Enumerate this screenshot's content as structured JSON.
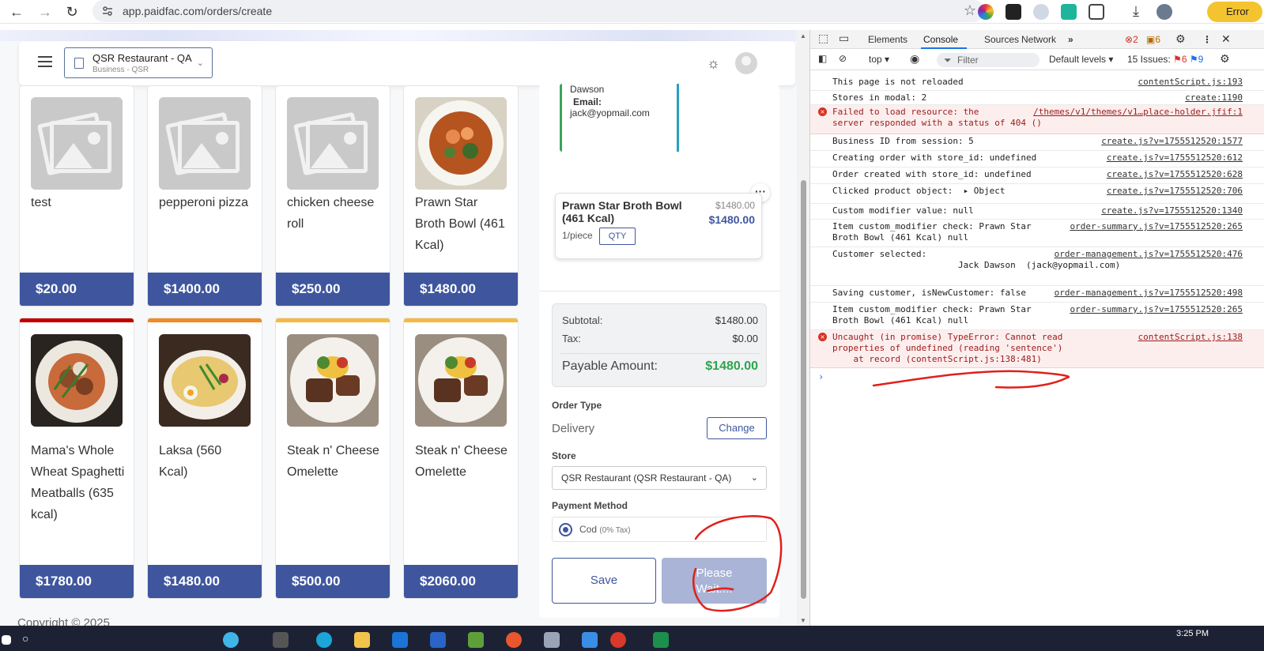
{
  "browser": {
    "url": "app.paidfac.com/orders/create",
    "error_pill": "Error"
  },
  "header": {
    "store_name": "QSR Restaurant - QA",
    "store_sub": "Business - QSR"
  },
  "products": [
    {
      "name": "test",
      "price": "$20.00",
      "image": "placeholder"
    },
    {
      "name": "pepperoni pizza",
      "price": "$1400.00",
      "image": "placeholder"
    },
    {
      "name": "chicken cheese roll",
      "price": "$250.00",
      "image": "placeholder"
    },
    {
      "name": "Prawn Star Broth Bowl (461 Kcal)",
      "price": "$1480.00",
      "image": "soup"
    },
    {
      "name": "Mama's Whole Wheat Spaghetti Meatballs (635 kcal)",
      "price": "$1780.00",
      "image": "pasta",
      "band": "#c00000"
    },
    {
      "name": "Laksa (560 Kcal)",
      "price": "$1480.00",
      "image": "laksa",
      "band": "#f08a24"
    },
    {
      "name": "Steak n' Cheese Omelette",
      "price": "$500.00",
      "image": "steak",
      "band": "#f5b942"
    },
    {
      "name": "Steak n' Cheese Omelette",
      "price": "$2060.00",
      "image": "steak",
      "band": "#f5b942"
    }
  ],
  "customer": {
    "name_line": "Dawson",
    "email_label": "Email:",
    "email": "jack@yopmail.com"
  },
  "cart_item": {
    "name": "Prawn Star Broth Bowl (461 Kcal)",
    "original_price": "$1480.00",
    "price": "$1480.00",
    "unit": "1/piece",
    "qty_label": "QTY"
  },
  "totals": {
    "subtotal_label": "Subtotal:",
    "subtotal": "$1480.00",
    "tax_label": "Tax:",
    "tax": "$0.00",
    "payable_label": "Payable Amount:",
    "payable": "$1480.00"
  },
  "order_type": {
    "label": "Order Type",
    "value": "Delivery",
    "change_label": "Change"
  },
  "store_field": {
    "label": "Store",
    "value": "QSR Restaurant (QSR Restaurant - QA)"
  },
  "payment": {
    "label": "Payment Method",
    "option": "Cod",
    "option_note": "(0% Tax)"
  },
  "actions": {
    "save_label": "Save",
    "wait_label": "Please Wait...."
  },
  "footer": {
    "copyright": "Copyright © 2025"
  },
  "devtools": {
    "tabs": [
      "Elements",
      "Console",
      "Sources",
      "Network"
    ],
    "active_tab": "Console",
    "error_count": "2",
    "warn_count": "6",
    "context": "top",
    "filter_placeholder": "Filter",
    "levels": "Default levels",
    "issues_label": "15 Issues:",
    "issues_err": "6",
    "issues_info": "9",
    "messages": [
      {
        "text": "This page is not reloaded",
        "src": "contentScript.js:193",
        "level": "log"
      },
      {
        "text": "Stores in modal: 2",
        "src": "create:1190",
        "level": "log"
      },
      {
        "text": "Failed to load resource: the\nserver responded with a status of 404 ()",
        "src": "/themes/v1/themes/v1…place-holder.jfif:1",
        "level": "error"
      },
      {
        "text": "Business ID from session: 5",
        "src": "create.js?v=1755512520:1577",
        "level": "log"
      },
      {
        "text": "Creating order with store_id: undefined",
        "src": "create.js?v=1755512520:612",
        "level": "log"
      },
      {
        "text": "Order created with store_id: undefined",
        "src": "create.js?v=1755512520:628",
        "level": "log"
      },
      {
        "text": "Clicked product object:  ▸ Object",
        "src": "create.js?v=1755512520:706",
        "level": "log"
      },
      {
        "text": "Custom modifier value: null",
        "src": "create.js?v=1755512520:1340",
        "level": "log"
      },
      {
        "text": "Item custom_modifier check: Prawn Star\nBroth Bowl (461 Kcal) null",
        "src": "order-summary.js?v=1755512520:265",
        "level": "log"
      },
      {
        "text": "Customer selected:\n                        Jack Dawson  (jack@yopmail.com)",
        "src": "order-management.js?v=1755512520:476",
        "level": "log"
      },
      {
        "text": "Saving customer, isNewCustomer: false",
        "src": "order-management.js?v=1755512520:498",
        "level": "log"
      },
      {
        "text": "Item custom_modifier check: Prawn Star\nBroth Bowl (461 Kcal) null",
        "src": "order-summary.js?v=1755512520:265",
        "level": "log"
      },
      {
        "text": "Uncaught (in promise) TypeError: Cannot read\nproperties of undefined (reading 'sentence')\n    at record (contentScript.js:138:481)",
        "src": "contentScript.js:138",
        "level": "error"
      }
    ]
  },
  "taskbar": {
    "time": "3:25 PM"
  },
  "colors": {
    "brand": "#3f569e",
    "success": "#2ea44f",
    "annotation": "#e0201b"
  }
}
